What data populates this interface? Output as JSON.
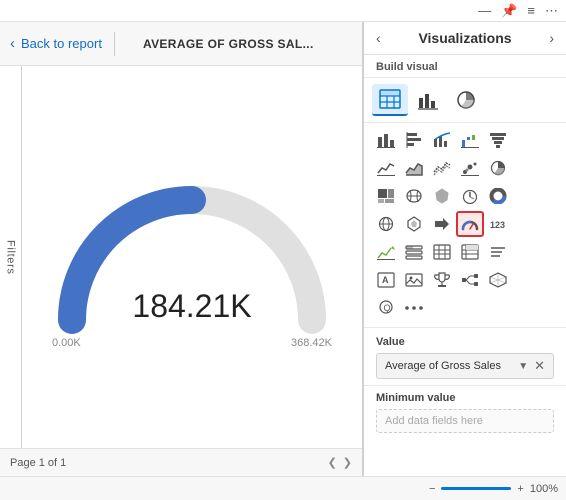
{
  "topbar": {
    "icons": [
      "—",
      "📌",
      "≡",
      "⋯"
    ]
  },
  "nav": {
    "back_label": "Back to report",
    "title": "AVERAGE OF GROSS SAL...",
    "divider": true
  },
  "filter_strip": {
    "label": "Filters"
  },
  "gauge": {
    "value": "184.21K",
    "min_label": "0.00K",
    "max_label": "368.42K",
    "fill_color": "#4472C4",
    "track_color": "#e0e0e0",
    "needle_color": "#333"
  },
  "footer": {
    "page_label": "Page 1 of 1"
  },
  "visualizations": {
    "title": "Visualizations",
    "nav_left": "‹",
    "nav_right": "›",
    "build_visual_label": "Build visual",
    "top_icons": [
      {
        "name": "table-icon",
        "glyph": "⊞",
        "active": true
      },
      {
        "name": "bar-chart-icon",
        "glyph": "📊"
      },
      {
        "name": "stacked-bar-icon",
        "glyph": "▦"
      }
    ],
    "icon_rows": [
      [
        {
          "name": "column-chart-icon",
          "glyph": "📈"
        },
        {
          "name": "bar-chart-2-icon",
          "glyph": "≡"
        },
        {
          "name": "combo-chart-icon",
          "glyph": "⊞"
        },
        {
          "name": "waterfall-icon",
          "glyph": "📉"
        },
        {
          "name": "funnel-icon",
          "glyph": "⌽"
        }
      ],
      [
        {
          "name": "line-chart-icon",
          "glyph": "〜"
        },
        {
          "name": "area-chart-icon",
          "glyph": "△"
        },
        {
          "name": "ribbon-chart-icon",
          "glyph": "〰"
        },
        {
          "name": "scatter-icon",
          "glyph": "⊕"
        },
        {
          "name": "pie-chart-icon",
          "glyph": "◔"
        }
      ],
      [
        {
          "name": "treemap-icon",
          "glyph": "▩"
        },
        {
          "name": "map-icon",
          "glyph": "🔻"
        },
        {
          "name": "filled-map-icon",
          "glyph": "◑"
        },
        {
          "name": "clock-icon",
          "glyph": "⏱"
        },
        {
          "name": "donut-icon",
          "glyph": "◎"
        }
      ],
      [
        {
          "name": "globe-icon",
          "glyph": "🌐"
        },
        {
          "name": "shape-map-icon",
          "glyph": "⬡"
        },
        {
          "name": "arrow-icon",
          "glyph": "➤"
        },
        {
          "name": "gauge-chart-icon",
          "glyph": "◑",
          "selected": true
        },
        {
          "name": "number-card-icon",
          "glyph": "123"
        }
      ],
      [
        {
          "name": "kpi-icon",
          "glyph": "△"
        },
        {
          "name": "slicer-icon",
          "glyph": "⊟"
        },
        {
          "name": "table2-icon",
          "glyph": "⊞"
        },
        {
          "name": "matrix-icon",
          "glyph": "⊠"
        },
        {
          "name": "smart-narrative-icon",
          "glyph": "≡"
        }
      ],
      [
        {
          "name": "text-box-icon",
          "glyph": "T"
        },
        {
          "name": "image-icon",
          "glyph": "⊡"
        },
        {
          "name": "trophy-icon",
          "glyph": "🏆"
        },
        {
          "name": "decomp-icon",
          "glyph": "📊"
        },
        {
          "name": "map2-icon",
          "glyph": "🗺"
        }
      ],
      [
        {
          "name": "qna-icon",
          "glyph": "⌘"
        },
        {
          "name": "ellipsis-icon",
          "glyph": "•••"
        }
      ]
    ],
    "value_section": {
      "label": "Value",
      "field_text": "Average of Gross Sales",
      "field_icons": [
        "▼",
        "✕"
      ]
    },
    "minimum_value_section": {
      "label": "Minimum value",
      "placeholder": "Add data fields here"
    }
  },
  "zoom_bar": {
    "minus_label": "−",
    "plus_label": "+",
    "percent_label": "100%"
  }
}
